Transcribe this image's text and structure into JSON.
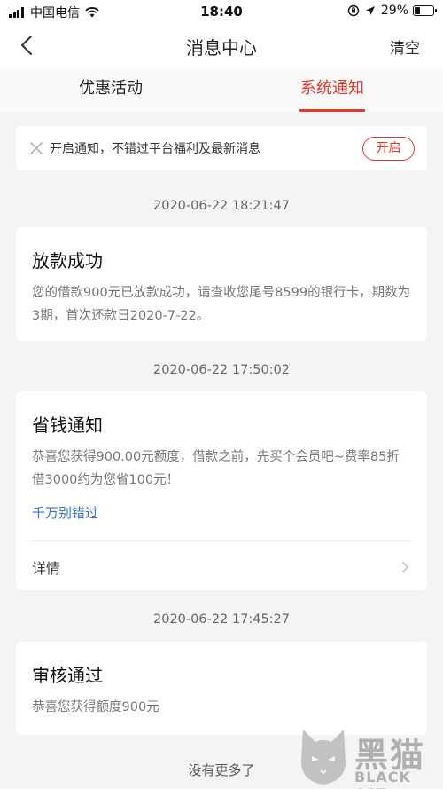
{
  "status_bar": {
    "carrier": "中国电信",
    "time": "18:40",
    "battery_percent": "29%",
    "battery_level": 0.29
  },
  "nav": {
    "title": "消息中心",
    "clear_label": "清空",
    "back_icon": "chevron-left-icon"
  },
  "tabs": [
    {
      "label": "优惠活动",
      "active": false
    },
    {
      "label": "系统通知",
      "active": true
    }
  ],
  "notify_bar": {
    "text": "开启通知，不错过平台福利及最新消息",
    "button_label": "开启",
    "close_icon": "close-icon"
  },
  "messages": [
    {
      "timestamp": "2020-06-22 18:21:47",
      "title": "放款成功",
      "body": "您的借款900元已放款成功，请查收您尾号8599的银行卡，期数为3期，首次还款日2020-7-22。"
    },
    {
      "timestamp": "2020-06-22 17:50:02",
      "title": "省钱通知",
      "body": "恭喜您获得900.00元额度，借款之前，先买个会员吧~费率85折借3000约为您省100元！",
      "link": "千万别错过",
      "detail_label": "详情"
    },
    {
      "timestamp": "2020-06-22 17:45:27",
      "title": "审核通过",
      "body": "恭喜您获得额度900元"
    }
  ],
  "footer": {
    "no_more": "没有更多了"
  },
  "watermark": {
    "cn": "黑猫",
    "en": "BLACK CAT"
  },
  "colors": {
    "accent": "#e8372c",
    "link": "#3b73d1",
    "background": "#f4f4f4"
  }
}
